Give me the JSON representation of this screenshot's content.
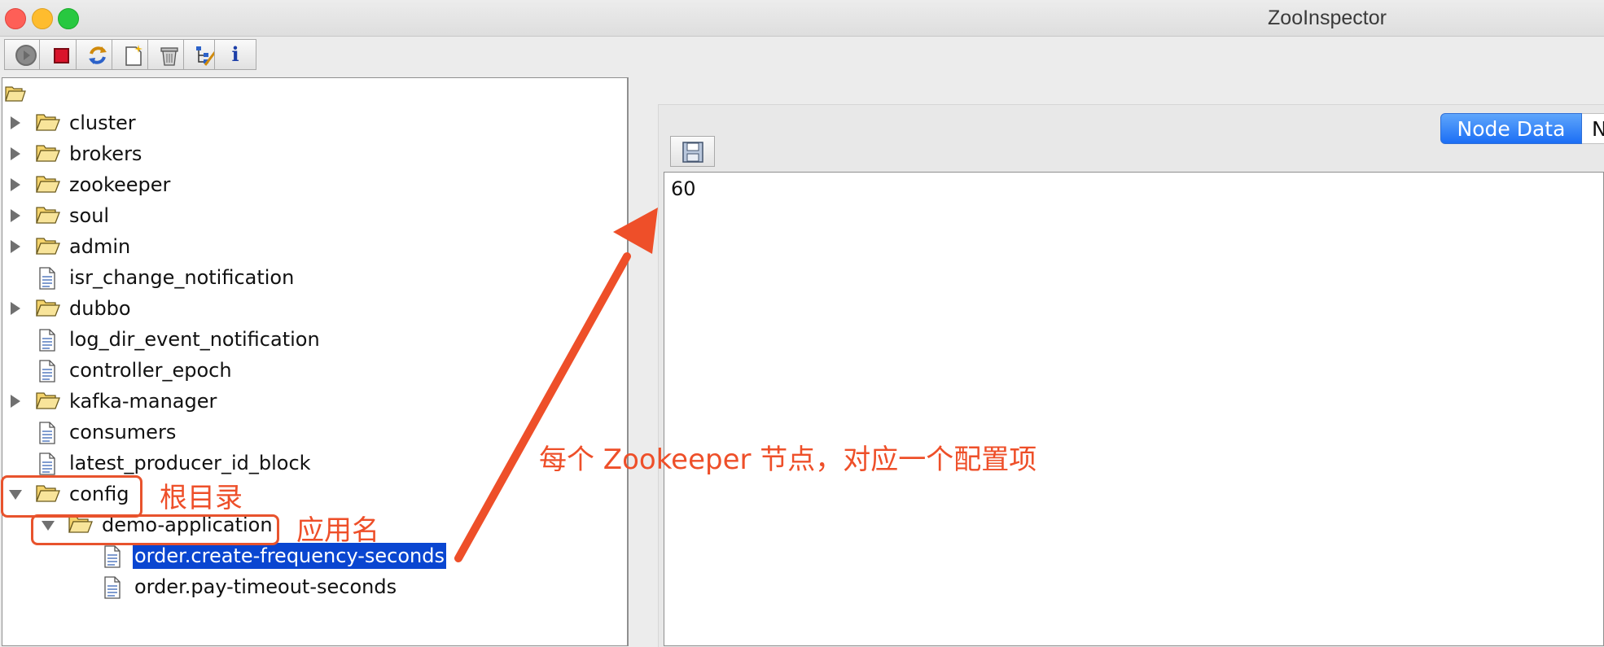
{
  "window": {
    "title": "ZooInspector"
  },
  "toolbar": {
    "buttons": [
      {
        "name": "connect-button",
        "icon": "connect-icon"
      },
      {
        "name": "disconnect-button",
        "icon": "stop-icon"
      },
      {
        "name": "refresh-button",
        "icon": "refresh-icon"
      },
      {
        "name": "add-node-button",
        "icon": "add-node-icon"
      },
      {
        "name": "delete-node-button",
        "icon": "trash-icon"
      },
      {
        "name": "node-viewers-button",
        "icon": "tree-edit-icon"
      },
      {
        "name": "about-button",
        "icon": "info-icon",
        "label": "i"
      }
    ]
  },
  "tree": {
    "nodes": [
      {
        "label": "cluster",
        "type": "folder",
        "expandable": true,
        "expanded": false,
        "depth": 0
      },
      {
        "label": "brokers",
        "type": "folder",
        "expandable": true,
        "expanded": false,
        "depth": 0
      },
      {
        "label": "zookeeper",
        "type": "folder",
        "expandable": true,
        "expanded": false,
        "depth": 0
      },
      {
        "label": "soul",
        "type": "folder",
        "expandable": true,
        "expanded": false,
        "depth": 0
      },
      {
        "label": "admin",
        "type": "folder",
        "expandable": true,
        "expanded": false,
        "depth": 0
      },
      {
        "label": "isr_change_notification",
        "type": "file",
        "expandable": false,
        "depth": 0
      },
      {
        "label": "dubbo",
        "type": "folder",
        "expandable": true,
        "expanded": false,
        "depth": 0
      },
      {
        "label": "log_dir_event_notification",
        "type": "file",
        "expandable": false,
        "depth": 0
      },
      {
        "label": "controller_epoch",
        "type": "file",
        "expandable": false,
        "depth": 0
      },
      {
        "label": "kafka-manager",
        "type": "folder",
        "expandable": true,
        "expanded": false,
        "depth": 0
      },
      {
        "label": "consumers",
        "type": "file",
        "expandable": false,
        "depth": 0
      },
      {
        "label": "latest_producer_id_block",
        "type": "file",
        "expandable": false,
        "depth": 0
      },
      {
        "label": "config",
        "type": "folder",
        "expandable": true,
        "expanded": true,
        "depth": 0
      },
      {
        "label": "demo-application",
        "type": "folder",
        "expandable": true,
        "expanded": true,
        "depth": 1
      },
      {
        "label": "order.create-frequency-seconds",
        "type": "file",
        "expandable": false,
        "depth": 2,
        "selected": true
      },
      {
        "label": "order.pay-timeout-seconds",
        "type": "file",
        "expandable": false,
        "depth": 2
      }
    ]
  },
  "tabs": [
    {
      "label": "Node Data",
      "active": true
    },
    {
      "label": "Node Metadata",
      "active": false
    }
  ],
  "node_data": {
    "save_icon": "save-icon",
    "value": "60"
  },
  "annotations": {
    "root_dir": "根目录",
    "app_name": "应用名",
    "node_note": "每个 Zookeeper 节点，对应一个配置项"
  },
  "colors": {
    "annotation": "#ee4f29",
    "selection": "#0a46d1",
    "tab_active": "#1b6ef5",
    "close": "#fe5f57",
    "minimize": "#febc2e",
    "zoom": "#28c840"
  }
}
